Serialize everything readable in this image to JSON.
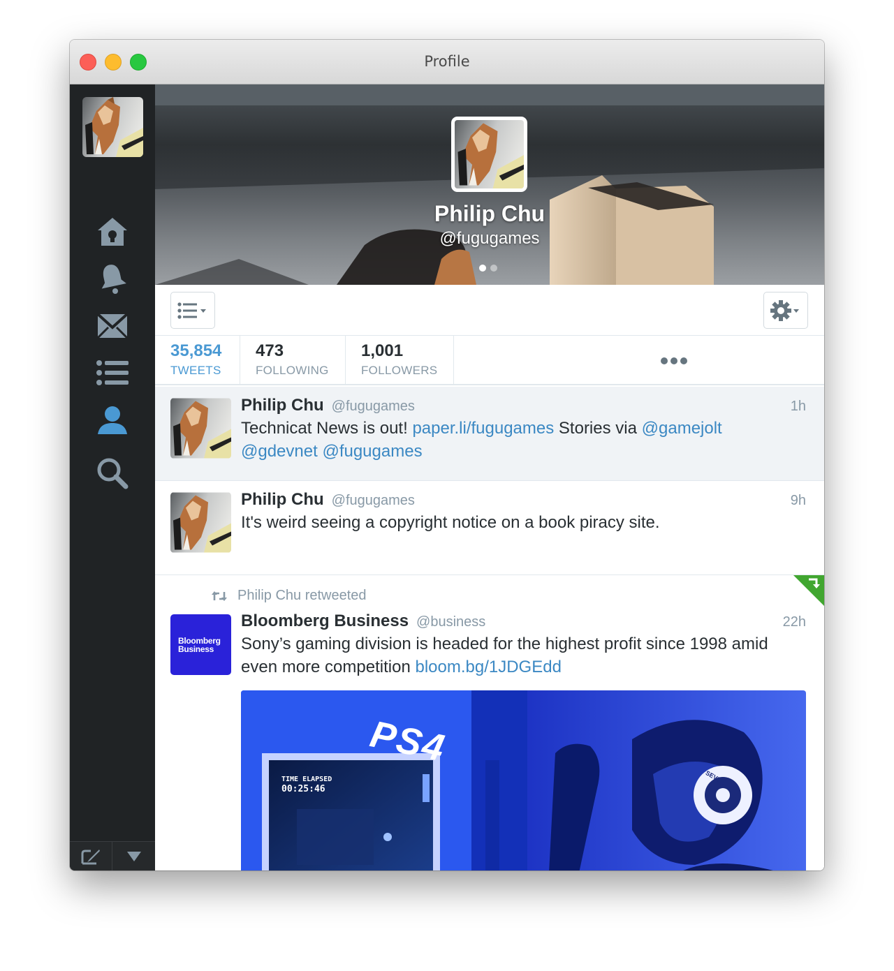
{
  "window": {
    "title": "Profile"
  },
  "sidebar": {
    "items": [
      {
        "name": "home",
        "icon": "home-icon"
      },
      {
        "name": "notifications",
        "icon": "bell-icon"
      },
      {
        "name": "messages",
        "icon": "envelope-icon"
      },
      {
        "name": "lists",
        "icon": "list-icon"
      },
      {
        "name": "profile",
        "icon": "profile-icon",
        "active": true
      },
      {
        "name": "search",
        "icon": "search-icon"
      }
    ],
    "bottom": {
      "compose_icon": "compose-icon",
      "menu_icon": "triangle-down-icon"
    }
  },
  "profile": {
    "name": "Philip Chu",
    "handle": "@fugugames",
    "banner_pages": 2,
    "banner_page_active": 1
  },
  "toolbar": {
    "list_icon": "list-menu-icon",
    "settings_icon": "gear-icon"
  },
  "stats": [
    {
      "value": "35,854",
      "label": "TWEETS",
      "active": true
    },
    {
      "value": "473",
      "label": "FOLLOWING"
    },
    {
      "value": "1,001",
      "label": "FOLLOWERS"
    }
  ],
  "stats_more": "•••",
  "tweets": [
    {
      "name": "Philip Chu",
      "handle": "@fugugames",
      "time": "1h",
      "text_parts": {
        "t1": "Technicat News is out! ",
        "l1": "paper.li/fugugames",
        "t2": " Stories via ",
        "l2": "@gamejolt",
        "l3": "@gdevnet",
        "l4": "@fugugames"
      }
    },
    {
      "name": "Philip Chu",
      "handle": "@fugugames",
      "time": "9h",
      "text": "It's weird seeing a copyright notice on a book piracy site."
    },
    {
      "retweeted_by": "Philip Chu retweeted",
      "name": "Bloomberg Business",
      "handle": "@business",
      "time": "22h",
      "avatar_text_1": "Bloomberg",
      "avatar_text_2": "Business",
      "text": "Sony’s gaming division is headed for the highest profit since 1998 amid even more competition ",
      "link": "bloom.bg/1JDGEdd",
      "media": {
        "brand_text": "PS4",
        "screen_label": "TIME ELAPSED",
        "screen_time": "00:25:46",
        "headset_text": "SEVEN"
      }
    }
  ],
  "colors": {
    "sidebar_bg": "#202325",
    "active_blue": "#4a99d3",
    "link_blue": "#3b88c3",
    "retweet_green": "#41a630",
    "bloomberg_blue": "#2a22d9"
  }
}
